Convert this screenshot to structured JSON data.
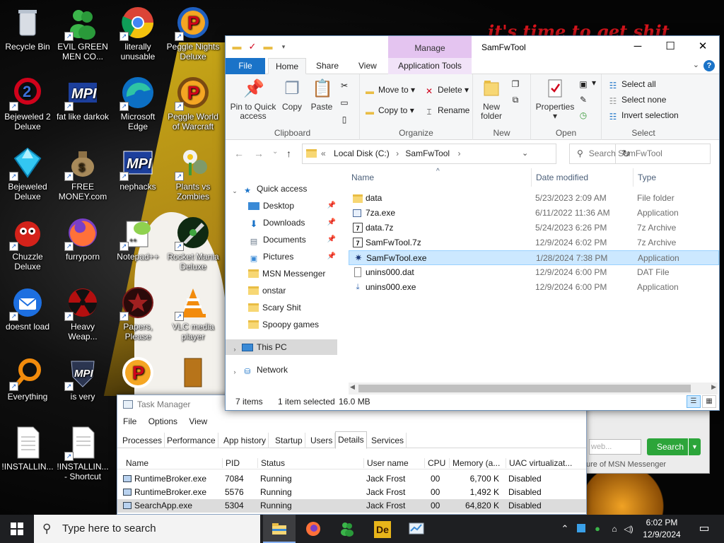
{
  "wallpaper": {
    "banner_text": "it's time to get shit"
  },
  "desktop_icons": [
    {
      "label": "Recycle Bin",
      "icon": "recycle-bin-icon"
    },
    {
      "label": "EVIL GREEN MEN CO...",
      "icon": "msn-people-icon"
    },
    {
      "label": "literally unusable",
      "icon": "chrome-icon"
    },
    {
      "label": "Peggle Nights Deluxe",
      "icon": "peggle-icon"
    },
    {
      "label": "Bejeweled 2 Deluxe",
      "icon": "bejeweled2-icon"
    },
    {
      "label": "fat like darkok",
      "icon": "mpi-icon"
    },
    {
      "label": "Microsoft Edge",
      "icon": "edge-icon"
    },
    {
      "label": "Peggle World of Warcraft",
      "icon": "peggle-wow-icon"
    },
    {
      "label": "Bejeweled Deluxe",
      "icon": "bejeweled-icon"
    },
    {
      "label": "FREE MONEY.com",
      "icon": "money-bag-icon"
    },
    {
      "label": "nephacks",
      "icon": "mpi-blue-icon"
    },
    {
      "label": "Plants vs Zombies",
      "icon": "pvz-icon"
    },
    {
      "label": "Chuzzle Deluxe",
      "icon": "chuzzle-icon"
    },
    {
      "label": "furryporn",
      "icon": "firefox-icon"
    },
    {
      "label": "Notepad++",
      "icon": "notepadpp-icon"
    },
    {
      "label": "Rocket Mania Deluxe",
      "icon": "rocket-mania-icon"
    },
    {
      "label": "doesnt load",
      "icon": "thunderbird-icon"
    },
    {
      "label": "Heavy Weap...",
      "icon": "radiation-icon"
    },
    {
      "label": "Papers, Please",
      "icon": "papers-please-icon"
    },
    {
      "label": "VLC media player",
      "icon": "vlc-icon"
    },
    {
      "label": "Everything",
      "icon": "everything-search-icon"
    },
    {
      "label": "is very",
      "icon": "mpi-shield-icon"
    },
    {
      "label": "",
      "icon": "peggle-icon"
    },
    {
      "label": "",
      "icon": "bronze-figure-icon"
    },
    {
      "label": "!INSTALLIN...",
      "icon": "text-file-icon"
    },
    {
      "label": "!INSTALLIN... - Shortcut",
      "icon": "text-file-icon"
    }
  ],
  "explorer": {
    "title": "SamFwTool",
    "context_tab": "Manage",
    "tabs": [
      "File",
      "Home",
      "Share",
      "View",
      "Application Tools"
    ],
    "ribbon": {
      "clipboard": {
        "label": "Clipboard",
        "pin": "Pin to Quick access",
        "copy": "Copy",
        "paste": "Paste"
      },
      "organize": {
        "label": "Organize",
        "move_to": "Move to",
        "copy_to": "Copy to",
        "delete": "Delete",
        "rename": "Rename"
      },
      "new": {
        "label": "New",
        "new_folder": "New folder"
      },
      "open": {
        "label": "Open",
        "properties": "Properties"
      },
      "select": {
        "label": "Select",
        "select_all": "Select all",
        "select_none": "Select none",
        "invert": "Invert selection"
      }
    },
    "address": {
      "sep": "«",
      "crumbs": [
        "Local Disk (C:)",
        "SamFwTool"
      ]
    },
    "search_placeholder": "Search SamFwTool",
    "nav": {
      "quick_access": "Quick access",
      "items": [
        {
          "label": "Desktop",
          "pinned": true
        },
        {
          "label": "Downloads",
          "pinned": true
        },
        {
          "label": "Documents",
          "pinned": true
        },
        {
          "label": "Pictures",
          "pinned": true
        },
        {
          "label": "MSN Messenger",
          "pinned": false
        },
        {
          "label": "onstar",
          "pinned": false
        },
        {
          "label": "Scary Shit",
          "pinned": false
        },
        {
          "label": "Spoopy games",
          "pinned": false
        }
      ],
      "this_pc": "This PC",
      "network": "Network"
    },
    "columns": [
      "Name",
      "Date modified",
      "Type"
    ],
    "files": [
      {
        "name": "data",
        "date": "5/23/2023 2:09 AM",
        "type": "File folder",
        "icon": "folder-icon"
      },
      {
        "name": "7za.exe",
        "date": "6/11/2022 11:36 AM",
        "type": "Application",
        "icon": "exe-icon"
      },
      {
        "name": "data.7z",
        "date": "5/24/2023 6:26 PM",
        "type": "7z Archive",
        "icon": "archive-icon"
      },
      {
        "name": "SamFwTool.7z",
        "date": "12/9/2024 6:02 PM",
        "type": "7z Archive",
        "icon": "archive-icon"
      },
      {
        "name": "SamFwTool.exe",
        "date": "1/28/2024 7:38 PM",
        "type": "Application",
        "icon": "samfwtool-icon"
      },
      {
        "name": "unins000.dat",
        "date": "12/9/2024 6:00 PM",
        "type": "DAT File",
        "icon": "dat-file-icon"
      },
      {
        "name": "unins000.exe",
        "date": "12/9/2024 6:00 PM",
        "type": "Application",
        "icon": "installer-icon"
      }
    ],
    "selected_file": "SamFwTool.exe",
    "status": {
      "count": "7 items",
      "selected": "1 item selected",
      "size": "16.0 MB"
    }
  },
  "msn": {
    "search_placeholder": "web...",
    "search_button": "Search",
    "footer": "ure of MSN Messenger"
  },
  "task_manager": {
    "title": "Task Manager",
    "menu": [
      "File",
      "Options",
      "View"
    ],
    "tabs": [
      "Processes",
      "Performance",
      "App history",
      "Startup",
      "Users",
      "Details",
      "Services"
    ],
    "active_tab": "Details",
    "columns": [
      "Name",
      "PID",
      "Status",
      "User name",
      "CPU",
      "Memory (a...",
      "UAC virtualizat..."
    ],
    "rows": [
      {
        "name": "RuntimeBroker.exe",
        "pid": "7084",
        "status": "Running",
        "user": "Jack Frost",
        "cpu": "00",
        "mem": "6,700 K",
        "uac": "Disabled"
      },
      {
        "name": "RuntimeBroker.exe",
        "pid": "5576",
        "status": "Running",
        "user": "Jack Frost",
        "cpu": "00",
        "mem": "1,492 K",
        "uac": "Disabled"
      },
      {
        "name": "SearchApp.exe",
        "pid": "5304",
        "status": "Running",
        "user": "Jack Frost",
        "cpu": "00",
        "mem": "64,820 K",
        "uac": "Disabled"
      }
    ]
  },
  "taskbar": {
    "search_placeholder": "Type here to search",
    "apps": [
      "file-explorer-icon",
      "firefox-icon",
      "msn-people-icon",
      "deluxe-game-icon",
      "task-manager-icon"
    ],
    "time": "6:02 PM",
    "date": "12/9/2024"
  }
}
